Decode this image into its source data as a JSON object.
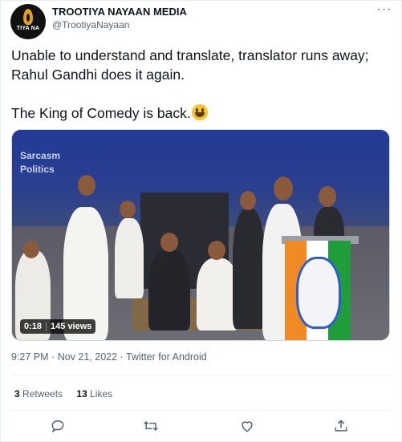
{
  "author": {
    "display_name": "TROOTIYA NAYAAN MEDIA",
    "handle": "@TrootiyaNayaan",
    "avatar_text": "TIYA NA"
  },
  "tweet": {
    "line1": "Unable to understand and translate, translator runs away; Rahul Gandhi does it again.",
    "line2": "The King of Comedy is back.",
    "emoji": "grinning-face-emoji"
  },
  "media": {
    "watermark_line1": "Sarcasm",
    "watermark_line2": "Politics",
    "duration": "0:18",
    "views": "145 views"
  },
  "meta": {
    "time": "9:27 PM",
    "date": "Nov 21, 2022",
    "separator": "·",
    "source": "Twitter for Android"
  },
  "stats": {
    "retweets_count": "3",
    "retweets_label": "Retweets",
    "likes_count": "13",
    "likes_label": "Likes"
  },
  "icons": {
    "more": "more-icon",
    "reply": "reply-icon",
    "retweet": "retweet-icon",
    "like": "like-icon",
    "share": "share-icon"
  },
  "colors": {
    "text": "#0f1419",
    "secondary": "#536471",
    "border": "#eff3f4"
  }
}
